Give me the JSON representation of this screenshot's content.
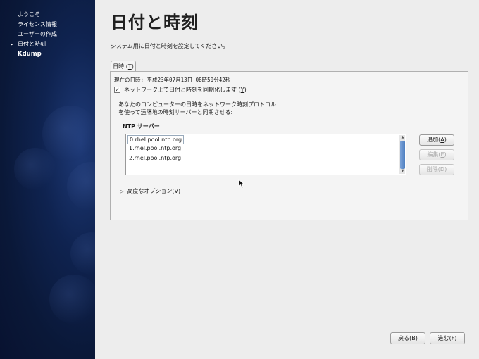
{
  "sidebar": {
    "items": [
      {
        "label": "ようこそ",
        "current": false
      },
      {
        "label": "ライセンス情報",
        "current": false
      },
      {
        "label": "ユーザーの作成",
        "current": false
      },
      {
        "label": "日付と時刻",
        "current": true
      },
      {
        "label": "Kdump",
        "current": false
      }
    ],
    "current_marker": "▸"
  },
  "main": {
    "title": "日付と時刻",
    "subtitle": "システム用に日付と時刻を設定してください。",
    "tab": {
      "label": "日時",
      "mnemonic": "T"
    },
    "current_time": "現在の日時:  平成23年07月13日 08時50分42秒",
    "sync_checkbox": {
      "label": "ネットワーク上で日付と時刻を同期化します",
      "mnemonic": "Y",
      "checked": true,
      "check_mark": "✓"
    },
    "description_line1": "あなたのコンピューターの日時をネットワーク時刻プロトコル",
    "description_line2": "を使って遠隔地の時刻サーバーと同期させる:",
    "ntp_title": "NTP サーバー",
    "ntp_servers": [
      "0.rhel.pool.ntp.org",
      "1.rhel.pool.ntp.org",
      "2.rhel.pool.ntp.org"
    ],
    "buttons": {
      "add": {
        "label": "追加",
        "mnemonic": "A"
      },
      "edit": {
        "label": "編集",
        "mnemonic": "E"
      },
      "delete": {
        "label": "削除",
        "mnemonic": "D"
      }
    },
    "advanced": {
      "label": "高度なオプション",
      "mnemonic": "V",
      "icon": "▷"
    }
  },
  "footer": {
    "back": {
      "label": "戻る",
      "mnemonic": "B"
    },
    "forward": {
      "label": "進む",
      "mnemonic": "F"
    }
  },
  "colors": {
    "sidebar_bg": "#0f2350",
    "accent_scrollbar": "#4f7fc0"
  }
}
